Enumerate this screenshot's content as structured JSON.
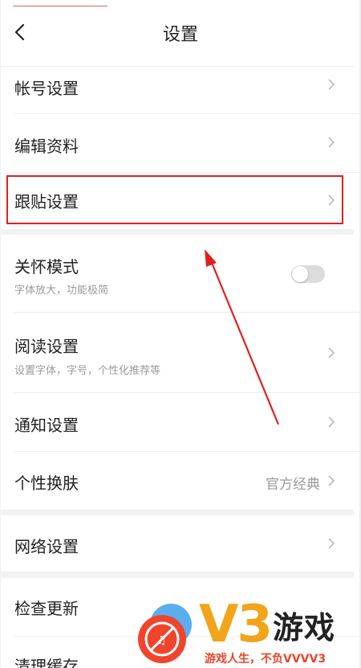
{
  "header": {
    "title": "设置"
  },
  "items": [
    {
      "label": "帐号设置"
    },
    {
      "label": "编辑资料"
    },
    {
      "label": "跟贴设置"
    },
    {
      "label": "关怀模式",
      "sub": "字体放大，功能极简",
      "toggle_on": false
    },
    {
      "label": "阅读设置",
      "sub": "设置字体，字号，个性化推荐等"
    },
    {
      "label": "通知设置"
    },
    {
      "label": "个性换肤",
      "value": "官方经典"
    },
    {
      "label": "网络设置"
    },
    {
      "label": "检查更新"
    },
    {
      "label": "清理缓存"
    }
  ],
  "watermark": {
    "logo": "V3",
    "name": "游戏",
    "tagline": "游戏人生，不负VVVV3"
  },
  "colors": {
    "highlight": "#e02020",
    "arrow": "#e02020",
    "accent": "#f2a51a"
  },
  "icons": {
    "back": "chevron-left-icon",
    "row": "chevron-right-icon"
  }
}
